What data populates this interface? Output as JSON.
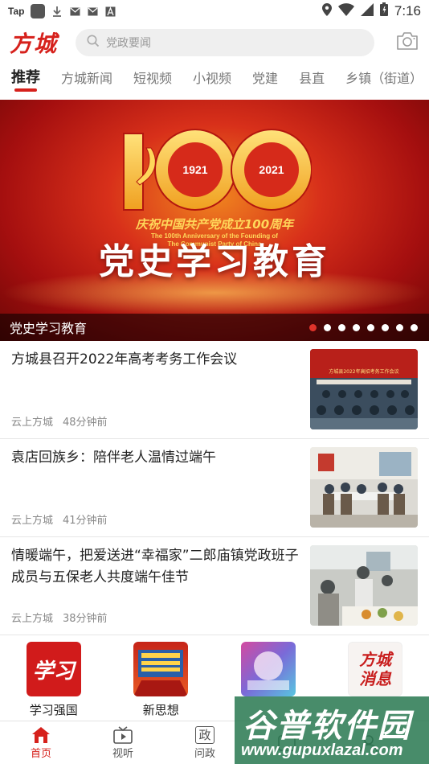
{
  "status_bar": {
    "app_label": "Tap",
    "time": "7:16"
  },
  "header": {
    "logo_text": "方城",
    "search_placeholder": "党政要闻"
  },
  "tabs": [
    {
      "label": "推荐",
      "active": true
    },
    {
      "label": "方城新闻"
    },
    {
      "label": "短视频"
    },
    {
      "label": "小视频"
    },
    {
      "label": "党建"
    },
    {
      "label": "县直"
    },
    {
      "label": "乡镇（街道）"
    }
  ],
  "banner": {
    "emblem_years": [
      "1921",
      "2021"
    ],
    "hundred": "100",
    "subtitle_cn": "庆祝中国共产党成立100周年",
    "subtitle_en_1": "The 100th Anniversary of the Founding of",
    "subtitle_en_2": "The Communist Party of China",
    "main_text": "党史学习教育",
    "caption": "党史学习教育",
    "slide_count": 8,
    "active_slide": 0
  },
  "news": [
    {
      "title": "方城县召开2022年高考考务工作会议",
      "source": "云上方城",
      "time": "48分钟前",
      "thumb_caption": "方城县2022年高招考务工作会议"
    },
    {
      "title": "袁店回族乡：陪伴老人温情过端午",
      "source": "云上方城",
      "time": "41分钟前"
    },
    {
      "title": "情暖端午，把爱送进“幸福家”二郎庙镇党政班子成员与五保老人共度端午佳节",
      "source": "云上方城",
      "time": "38分钟前"
    }
  ],
  "apps": [
    {
      "label": "学习强国",
      "icon_text": "学习"
    },
    {
      "label": "新思想"
    },
    {
      "label": ""
    },
    {
      "label": "",
      "icon_text": "方城消息"
    }
  ],
  "bottom_nav": [
    {
      "label": "首页",
      "icon": "home-icon",
      "active": true
    },
    {
      "label": "视听",
      "icon": "tv-icon"
    },
    {
      "label": "问政",
      "icon": "zheng-icon",
      "icon_text": "政"
    },
    {
      "label": "",
      "icon": "service-icon"
    },
    {
      "label": "",
      "icon": "me-icon"
    }
  ],
  "watermark": {
    "text": "谷普软件园",
    "url": "www.gupuxlazal.com"
  },
  "colors": {
    "accent": "#d6211c",
    "banner_red": "#a50f0f"
  }
}
